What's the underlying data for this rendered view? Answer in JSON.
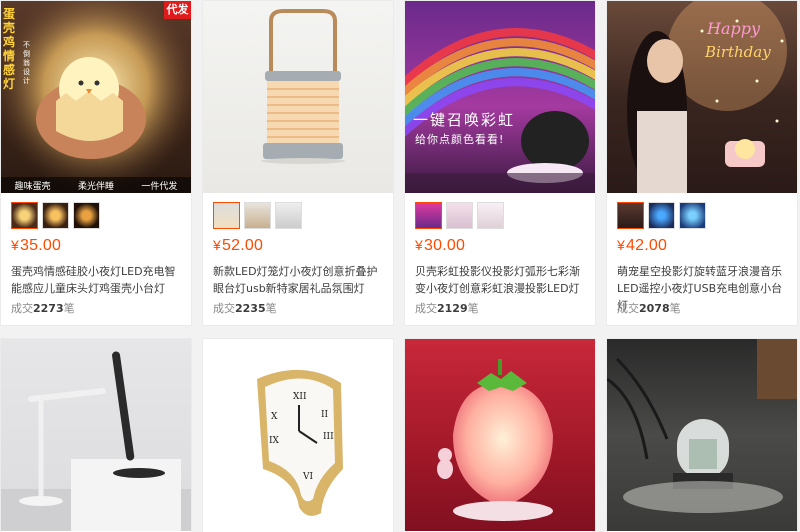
{
  "products": [
    {
      "price": "35.00",
      "currency": "¥",
      "title": "蛋壳鸡情感硅胶小夜灯LED充电智能感应儿童床头灯鸡蛋壳小台灯",
      "sales_label": "成交",
      "sales_count": "2273",
      "sales_unit": "笔",
      "image_text": {
        "vertical": "蛋壳鸡情感灯",
        "badge": "代发",
        "small": "不倒翁设计",
        "bottom": [
          "趣味蛋壳",
          "柔光伴睡",
          "一件代发"
        ]
      }
    },
    {
      "price": "52.00",
      "currency": "¥",
      "title": "新款LED灯笼灯小夜灯创意折叠护眼台灯usb新特家居礼品氛围灯",
      "sales_label": "成交",
      "sales_count": "2235",
      "sales_unit": "笔"
    },
    {
      "price": "30.00",
      "currency": "¥",
      "title": "贝壳彩虹投影仪投影灯弧形七彩渐变小夜灯创意彩虹浪漫投影LED灯",
      "sales_label": "成交",
      "sales_count": "2129",
      "sales_unit": "笔",
      "image_text": {
        "line1": "一键召唤彩虹",
        "line2": "给你点颜色看看!"
      }
    },
    {
      "price": "42.00",
      "currency": "¥",
      "title": "萌宠星空投影灯旋转蓝牙浪漫音乐LED遥控小夜灯USB充电创意小台灯",
      "sales_label": "成交",
      "sales_count": "2078",
      "sales_unit": "笔",
      "image_text": {
        "happy": "Happy",
        "birthday": "Birthday"
      }
    }
  ],
  "colors": {
    "price": "#ff4a00",
    "badge": "#e01b1b"
  }
}
